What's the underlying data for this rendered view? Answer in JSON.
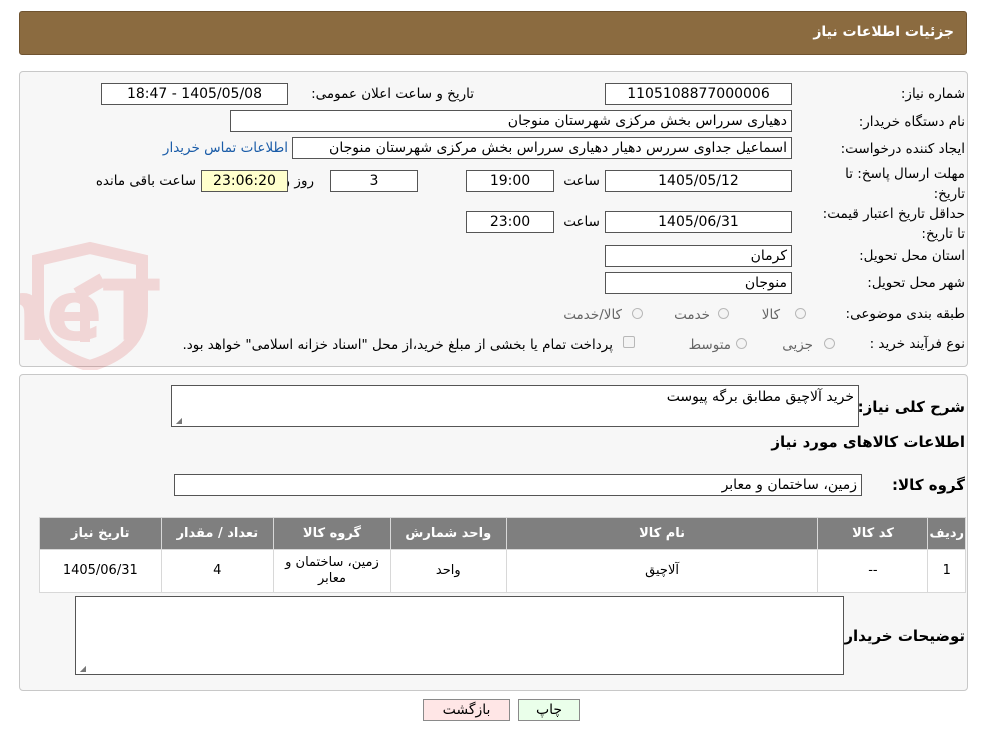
{
  "header": {
    "title": "جزئیات اطلاعات نیاز"
  },
  "form": {
    "need_number_label": "شماره نیاز:",
    "need_number": "1105108877000006",
    "announce_label": "تاریخ و ساعت اعلان عمومی:",
    "announce_value": "1405/05/08 - 18:47",
    "buyer_org_label": "نام دستگاه خریدار:",
    "buyer_org": "دهیاری سرراس بخش مرکزی شهرستان منوجان",
    "requester_label": "ایجاد کننده درخواست:",
    "requester": "اسماعیل جداوی سررس دهیار دهیاری سرراس بخش مرکزی شهرستان منوجان",
    "contact_link": "اطلاعات تماس خریدار",
    "deadline_label": "مهلت ارسال پاسخ: تا تاریخ:",
    "deadline_date": "1405/05/12",
    "time_label": "ساعت",
    "deadline_time": "19:00",
    "days_value": "3",
    "days_label": "روز و",
    "remaining_time": "23:06:20",
    "remaining_label": "ساعت باقی مانده",
    "validity_label": "حداقل تاریخ اعتبار قیمت: تا تاریخ:",
    "validity_date": "1405/06/31",
    "validity_time_label": "ساعت",
    "validity_time": "23:00",
    "province_label": "استان محل تحویل:",
    "province": "کرمان",
    "city_label": "شهر محل تحویل:",
    "city": "منوجان",
    "category_label": "طبقه بندی موضوعی:",
    "category_options": [
      "کالا",
      "خدمت",
      "کالا/خدمت"
    ],
    "process_label": "نوع فرآیند خرید :",
    "process_options": [
      "جزیی",
      "متوسط"
    ],
    "payment_note": "پرداخت تمام یا بخشی از مبلغ خرید،از محل \"اسناد خزانه اسلامی\" خواهد بود."
  },
  "details": {
    "description_label": "شرح کلی نیاز:",
    "description": "خرید آلاچیق مطابق برگه پیوست",
    "goods_info_title": "اطلاعات کالاهای مورد نیاز",
    "goods_group_label": "گروه کالا:",
    "goods_group": "زمین، ساختمان و معابر",
    "table": {
      "headers": [
        "ردیف",
        "کد کالا",
        "نام کالا",
        "واحد شمارش",
        "گروه کالا",
        "تعداد / مقدار",
        "تاریخ نیاز"
      ],
      "rows": [
        [
          "1",
          "--",
          "آلاچیق",
          "واحد",
          "زمین، ساختمان و معابر",
          "4",
          "1405/06/31"
        ]
      ]
    },
    "buyer_notes_label": "توضیحات خریدار:",
    "buyer_notes": ""
  },
  "buttons": {
    "print": "چاپ",
    "back": "بازگشت"
  },
  "watermark": {
    "text": "AriaTender.neT"
  },
  "colors": {
    "header_bg": "#8b6b40",
    "table_header_bg": "#7f7f7f",
    "link": "#1a5ca8",
    "remaining_bg": "#ffffcc"
  }
}
